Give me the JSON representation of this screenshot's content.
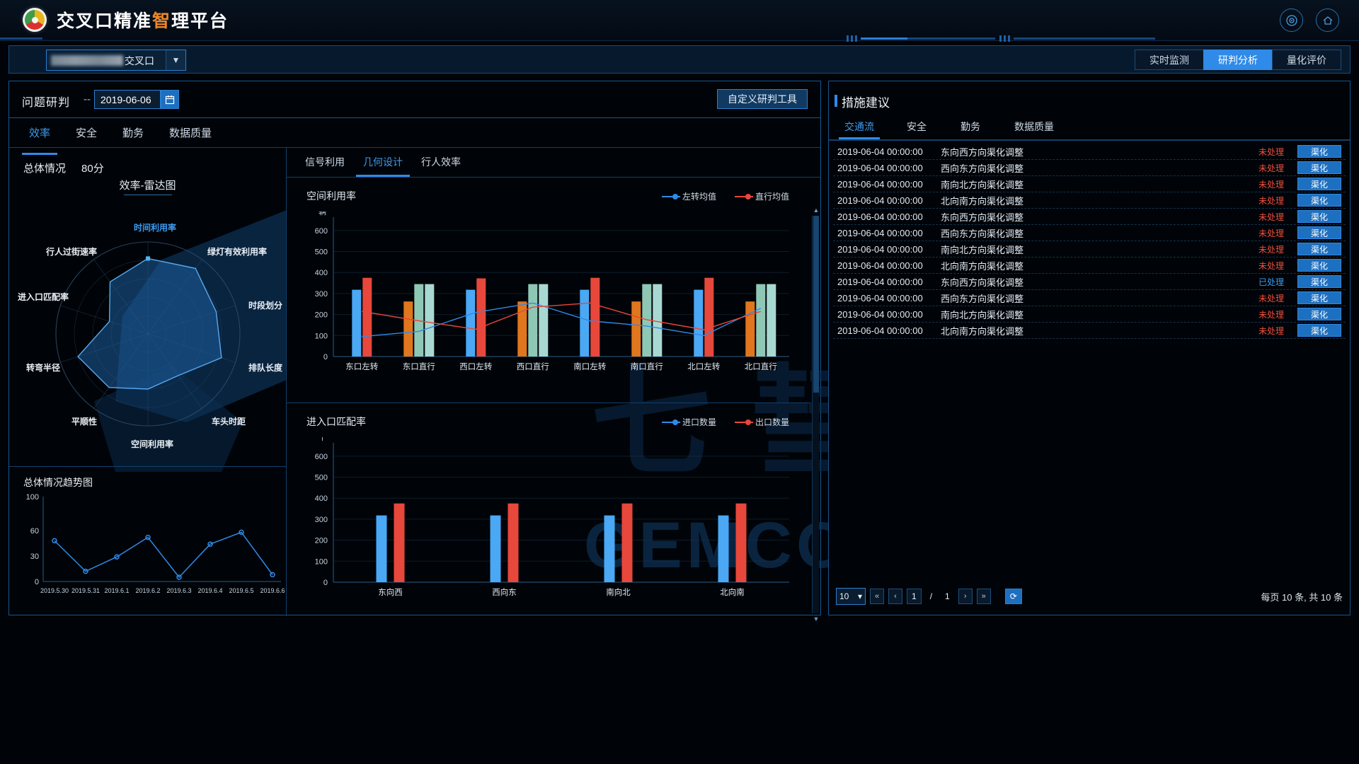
{
  "header": {
    "title_main": "交叉口精准",
    "title_hl": "智",
    "title_tail": "理平台",
    "logo_name": "platform-logo",
    "icon_target": "⊙",
    "icon_home": "⌂"
  },
  "topbar": {
    "select_value": "交叉口",
    "caret": "▼",
    "modes": [
      {
        "label": "实时监测",
        "active": false
      },
      {
        "label": "研判分析",
        "active": true
      },
      {
        "label": "量化评价",
        "active": false
      }
    ]
  },
  "main": {
    "panel_label": "问题研判",
    "dash": "--",
    "date_value": "2019-06-06",
    "date_icon": "▤",
    "tool_button": "自定义研判工具",
    "tabs": [
      {
        "label": "效率",
        "active": true
      },
      {
        "label": "安全",
        "active": false
      },
      {
        "label": "勤务",
        "active": false
      },
      {
        "label": "数据质量",
        "active": false
      }
    ],
    "overall_label": "总体情况",
    "overall_score": "80分",
    "radar_title": "效率-雷达图",
    "subtabs": [
      {
        "label": "信号利用",
        "active": false
      },
      {
        "label": "几何设计",
        "active": true
      },
      {
        "label": "行人效率",
        "active": false
      }
    ],
    "watermark1": "七 彗 存",
    "watermark2": "GEMCODER"
  },
  "side": {
    "title": "措施建议",
    "tabs": [
      {
        "label": "交通流",
        "active": true
      },
      {
        "label": "安全",
        "active": false
      },
      {
        "label": "勤务",
        "active": false
      },
      {
        "label": "数据质量",
        "active": false
      }
    ],
    "rows": [
      {
        "time": "2019-06-04 00:00:00",
        "desc": "东向西方向渠化调整",
        "state": "未处理",
        "done": false,
        "action": "渠化"
      },
      {
        "time": "2019-06-04 00:00:00",
        "desc": "西向东方向渠化调整",
        "state": "未处理",
        "done": false,
        "action": "渠化"
      },
      {
        "time": "2019-06-04 00:00:00",
        "desc": "南向北方向渠化调整",
        "state": "未处理",
        "done": false,
        "action": "渠化"
      },
      {
        "time": "2019-06-04 00:00:00",
        "desc": "北向南方向渠化调整",
        "state": "未处理",
        "done": false,
        "action": "渠化"
      },
      {
        "time": "2019-06-04 00:00:00",
        "desc": "东向西方向渠化调整",
        "state": "未处理",
        "done": false,
        "action": "渠化"
      },
      {
        "time": "2019-06-04 00:00:00",
        "desc": "西向东方向渠化调整",
        "state": "未处理",
        "done": false,
        "action": "渠化"
      },
      {
        "time": "2019-06-04 00:00:00",
        "desc": "南向北方向渠化调整",
        "state": "未处理",
        "done": false,
        "action": "渠化"
      },
      {
        "time": "2019-06-04 00:00:00",
        "desc": "北向南方向渠化调整",
        "state": "未处理",
        "done": false,
        "action": "渠化"
      },
      {
        "time": "2019-06-04 00:00:00",
        "desc": "东向西方向渠化调整",
        "state": "已处理",
        "done": true,
        "action": "渠化"
      },
      {
        "time": "2019-06-04 00:00:00",
        "desc": "西向东方向渠化调整",
        "state": "未处理",
        "done": false,
        "action": "渠化"
      },
      {
        "time": "2019-06-04 00:00:00",
        "desc": "南向北方向渠化调整",
        "state": "未处理",
        "done": false,
        "action": "渠化"
      },
      {
        "time": "2019-06-04 00:00:00",
        "desc": "北向南方向渠化调整",
        "state": "未处理",
        "done": false,
        "action": "渠化"
      }
    ],
    "pager": {
      "page_size": "10",
      "first": "«",
      "prev": "‹",
      "current": "1",
      "separator": "/",
      "total_pages": "1",
      "next": "›",
      "last": "»",
      "refresh": "⟳",
      "info": "每页 10 条, 共 10 条"
    }
  },
  "chart_data": [
    {
      "type": "radar",
      "title": "效率-雷达图",
      "indicators": [
        {
          "name": "时间利用率",
          "value": 82,
          "max": 100,
          "highlight": true
        },
        {
          "name": "绿灯有效利用率",
          "value": 88,
          "max": 100,
          "highlight": false
        },
        {
          "name": "时段划分",
          "value": 78,
          "max": 100,
          "highlight": false
        },
        {
          "name": "排队长度",
          "value": 84,
          "max": 100,
          "highlight": false
        },
        {
          "name": "车头时距",
          "value": 56,
          "max": 100,
          "highlight": false
        },
        {
          "name": "空间利用率",
          "value": 60,
          "max": 100,
          "highlight": false
        },
        {
          "name": "平顺性",
          "value": 72,
          "max": 100,
          "highlight": false
        },
        {
          "name": "转弯半径",
          "value": 80,
          "max": 100,
          "highlight": false
        },
        {
          "name": "进入口匹配率",
          "value": 44,
          "max": 100,
          "highlight": false
        },
        {
          "name": "行人过街速率",
          "value": 70,
          "max": 100,
          "highlight": false
        }
      ],
      "series_color": "#2f8ae8",
      "rings": 5
    },
    {
      "type": "line",
      "title": "总体情况趋势图",
      "x": [
        "2019.5.30",
        "2019.5.31",
        "2019.6.1",
        "2019.6.2",
        "2019.6.3",
        "2019.6.4",
        "2019.6.5",
        "2019.6.6"
      ],
      "values": [
        48,
        12,
        29,
        52,
        5,
        44,
        58,
        8
      ],
      "ylim": [
        0,
        100
      ],
      "yticks": [
        0,
        30,
        60,
        100
      ],
      "line_color": "#2f8ae8",
      "grid": false
    },
    {
      "type": "bar",
      "title": "空间利用率",
      "yunit": "辆",
      "ylim": [
        0,
        650
      ],
      "yticks": [
        0,
        100,
        200,
        300,
        400,
        500,
        600
      ],
      "categories": [
        "东口左转",
        "东口直行",
        "西口左转",
        "西口直行",
        "南口左转",
        "南口直行",
        "北口左转",
        "北口直行"
      ],
      "bar_series": [
        {
          "name": "blue",
          "color": "#4aa8f5",
          "values": [
            318,
            0,
            318,
            0,
            318,
            0,
            318,
            0
          ]
        },
        {
          "name": "red",
          "color": "#e8473b",
          "values": [
            375,
            0,
            372,
            0,
            375,
            0,
            375,
            0
          ]
        },
        {
          "name": "orange",
          "color": "#e0761d",
          "values": [
            0,
            262,
            0,
            262,
            0,
            262,
            0,
            262
          ]
        },
        {
          "name": "teal",
          "color": "#8fc7b5",
          "values": [
            0,
            345,
            0,
            345,
            0,
            345,
            0,
            345
          ]
        },
        {
          "name": "aqua",
          "color": "#a8d8d2",
          "values": [
            0,
            345,
            0,
            345,
            0,
            345,
            0,
            345
          ]
        }
      ],
      "line_series": [
        {
          "name": "左转均值",
          "color": "#2f8ae8",
          "values": [
            95,
            120,
            210,
            255,
            170,
            145,
            100,
            230
          ]
        },
        {
          "name": "直行均值",
          "color": "#e8473b",
          "values": [
            215,
            170,
            130,
            235,
            255,
            175,
            128,
            215
          ]
        }
      ],
      "legend": [
        "左转均值",
        "直行均值"
      ]
    },
    {
      "type": "bar",
      "title": "进入口匹配率",
      "yunit": "个",
      "ylim": [
        0,
        650
      ],
      "yticks": [
        0,
        100,
        200,
        300,
        400,
        500,
        600
      ],
      "categories": [
        "东向西",
        "西向东",
        "南向北",
        "北向南"
      ],
      "bar_series": [
        {
          "name": "进口数量",
          "color": "#4aa8f5",
          "values": [
            318,
            318,
            318,
            318
          ]
        },
        {
          "name": "出口数量",
          "color": "#e8473b",
          "values": [
            375,
            375,
            375,
            375
          ]
        }
      ],
      "legend": [
        "进口数量",
        "出口数量"
      ]
    }
  ]
}
